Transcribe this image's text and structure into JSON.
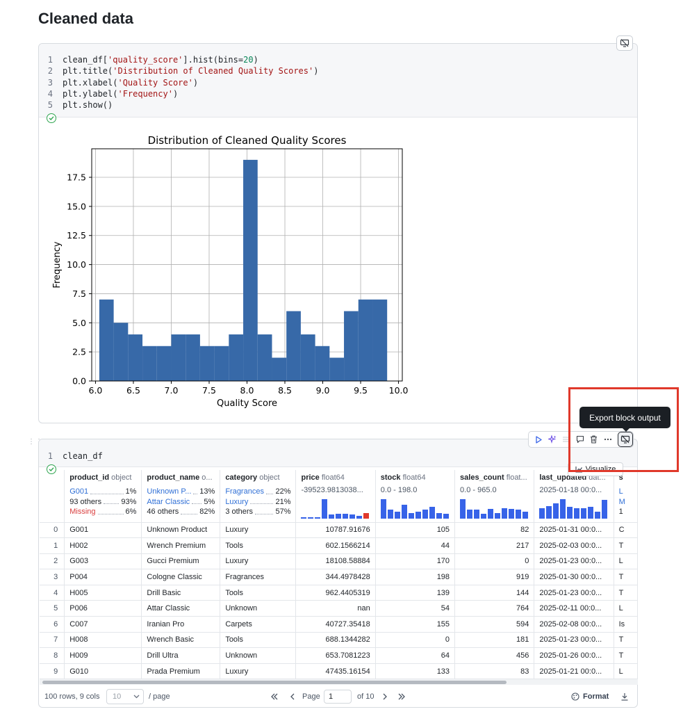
{
  "page": {
    "title": "Cleaned data"
  },
  "cell1": {
    "code_lines": [
      {
        "num": "1",
        "tokens": [
          {
            "t": "clean_df[",
            "c": "txt"
          },
          {
            "t": "'quality_score'",
            "c": "str"
          },
          {
            "t": "].hist(bins=",
            "c": "txt"
          },
          {
            "t": "20",
            "c": "num"
          },
          {
            "t": ")",
            "c": "txt"
          }
        ]
      },
      {
        "num": "2",
        "tokens": [
          {
            "t": "plt.title(",
            "c": "txt"
          },
          {
            "t": "'Distribution of Cleaned Quality Scores'",
            "c": "str"
          },
          {
            "t": ")",
            "c": "txt"
          }
        ]
      },
      {
        "num": "3",
        "tokens": [
          {
            "t": "plt.xlabel(",
            "c": "txt"
          },
          {
            "t": "'Quality Score'",
            "c": "str"
          },
          {
            "t": ")",
            "c": "txt"
          }
        ]
      },
      {
        "num": "4",
        "tokens": [
          {
            "t": "plt.ylabel(",
            "c": "txt"
          },
          {
            "t": "'Frequency'",
            "c": "str"
          },
          {
            "t": ")",
            "c": "txt"
          }
        ]
      },
      {
        "num": "5",
        "tokens": [
          {
            "t": "plt.show()",
            "c": "txt"
          }
        ]
      }
    ]
  },
  "chart_data": {
    "type": "bar",
    "title": "Distribution of Cleaned Quality Scores",
    "xlabel": "Quality Score",
    "ylabel": "Frequency",
    "bin_edges": [
      6.05,
      6.24,
      6.43,
      6.62,
      6.81,
      7.0,
      7.19,
      7.38,
      7.57,
      7.76,
      7.95,
      8.14,
      8.33,
      8.52,
      8.71,
      8.9,
      9.09,
      9.28,
      9.47,
      9.66,
      9.85
    ],
    "values": [
      7,
      5,
      4,
      3,
      3,
      4,
      4,
      3,
      3,
      4,
      19,
      4,
      2,
      6,
      4,
      3,
      2,
      6,
      7,
      7
    ],
    "xlim": [
      5.95,
      10.05
    ],
    "ylim": [
      0,
      19.95
    ],
    "xticks": [
      "6.0",
      "6.5",
      "7.0",
      "7.5",
      "8.0",
      "8.5",
      "9.0",
      "9.5",
      "10.0"
    ],
    "xtick_values": [
      6.0,
      6.5,
      7.0,
      7.5,
      8.0,
      8.5,
      9.0,
      9.5,
      10.0
    ],
    "yticks": [
      "0.0",
      "2.5",
      "5.0",
      "7.5",
      "10.0",
      "12.5",
      "15.0",
      "17.5"
    ],
    "ytick_values": [
      0,
      2.5,
      5,
      7.5,
      10,
      12.5,
      15,
      17.5
    ],
    "grid": true,
    "bar_color": "#3769a8"
  },
  "cell2": {
    "code_lines": [
      {
        "num": "1",
        "tokens": [
          {
            "t": "clean_df",
            "c": "txt"
          }
        ]
      }
    ],
    "tooltip": "Export block output",
    "visualize_label": "Visualize",
    "toolbar_icons": [
      "run-icon",
      "ai-sparkle-icon",
      "list-icon",
      "comment-icon",
      "trash-icon",
      "more-icon"
    ]
  },
  "table": {
    "columns": [
      {
        "name": "product_id",
        "type": "object",
        "kind": "cat",
        "stats": [
          {
            "label": "G001",
            "pct": "1%",
            "style": "blue"
          },
          {
            "label": "93 others",
            "pct": "93%",
            "style": ""
          },
          {
            "label": "Missing",
            "pct": "6%",
            "style": "red"
          }
        ]
      },
      {
        "name": "product_name",
        "type": "o...",
        "kind": "cat",
        "stats": [
          {
            "label": "Unknown P...",
            "pct": "13%",
            "style": "blue"
          },
          {
            "label": "Attar Classic",
            "pct": "5%",
            "style": "blue"
          },
          {
            "label": "46 others",
            "pct": "82%",
            "style": ""
          }
        ]
      },
      {
        "name": "category",
        "type": "object",
        "kind": "cat",
        "stats": [
          {
            "label": "Fragrances",
            "pct": "22%",
            "style": "blue"
          },
          {
            "label": "Luxury",
            "pct": "21%",
            "style": "blue"
          },
          {
            "label": "3 others",
            "pct": "57%",
            "style": ""
          }
        ]
      },
      {
        "name": "price",
        "type": "float64",
        "kind": "num",
        "range": "-39523.9813038...",
        "hist": [
          0.05,
          0.05,
          0.05,
          1.0,
          0.2,
          0.25,
          0.25,
          0.2,
          0.15,
          0.3
        ],
        "last_red": true
      },
      {
        "name": "stock",
        "type": "float64",
        "kind": "num",
        "range": "0.0 - 198.0",
        "hist": [
          1.0,
          0.45,
          0.35,
          0.7,
          0.3,
          0.35,
          0.45,
          0.6,
          0.3,
          0.25
        ],
        "last_red": false
      },
      {
        "name": "sales_count",
        "type": "float...",
        "kind": "num",
        "range": "0.0 - 965.0",
        "hist": [
          1.0,
          0.45,
          0.45,
          0.25,
          0.5,
          0.3,
          0.55,
          0.5,
          0.45,
          0.35
        ],
        "last_red": false
      },
      {
        "name": "last_updated",
        "type": "dat...",
        "kind": "num",
        "range": "2025-01-18 00:0...",
        "hist": [
          0.55,
          0.65,
          0.8,
          1.0,
          0.6,
          0.55,
          0.55,
          0.6,
          0.35,
          0.95
        ],
        "last_red": false
      },
      {
        "name": "s",
        "type": "",
        "kind": "cut",
        "stats_letters": [
          "L",
          "M",
          "1"
        ]
      }
    ],
    "rows": [
      {
        "idx": "0",
        "cells": [
          "G001",
          "Unknown Product",
          "Luxury",
          "10787.91676",
          "105",
          "82",
          "2025-01-31 00:0...",
          "C"
        ]
      },
      {
        "idx": "1",
        "cells": [
          "H002",
          "Wrench Premium",
          "Tools",
          "602.1566214",
          "44",
          "217",
          "2025-02-03 00:0...",
          "T"
        ]
      },
      {
        "idx": "2",
        "cells": [
          "G003",
          "Gucci Premium",
          "Luxury",
          "18108.58884",
          "170",
          "0",
          "2025-01-23 00:0...",
          "L"
        ]
      },
      {
        "idx": "3",
        "cells": [
          "P004",
          "Cologne Classic",
          "Fragrances",
          "344.4978428",
          "198",
          "919",
          "2025-01-30 00:0...",
          "T"
        ]
      },
      {
        "idx": "4",
        "cells": [
          "H005",
          "Drill Basic",
          "Tools",
          "962.4405319",
          "139",
          "144",
          "2025-01-23 00:0...",
          "T"
        ]
      },
      {
        "idx": "5",
        "cells": [
          "P006",
          "Attar Classic",
          "Unknown",
          "nan",
          "54",
          "764",
          "2025-02-11 00:0...",
          "L"
        ]
      },
      {
        "idx": "6",
        "cells": [
          "C007",
          "Iranian Pro",
          "Carpets",
          "40727.35418",
          "155",
          "594",
          "2025-02-08 00:0...",
          "Is"
        ]
      },
      {
        "idx": "7",
        "cells": [
          "H008",
          "Wrench Basic",
          "Tools",
          "688.1344282",
          "0",
          "181",
          "2025-01-23 00:0...",
          "T"
        ]
      },
      {
        "idx": "8",
        "cells": [
          "H009",
          "Drill Ultra",
          "Unknown",
          "653.7081223",
          "64",
          "456",
          "2025-01-26 00:0...",
          "T"
        ]
      },
      {
        "idx": "9",
        "cells": [
          "G010",
          "Prada Premium",
          "Luxury",
          "47435.16154",
          "133",
          "83",
          "2025-01-21 00:0...",
          "L"
        ]
      }
    ]
  },
  "footer": {
    "summary": "100 rows, 9 cols",
    "page_size": "10",
    "per_page": "/ page",
    "page_label": "Page",
    "page_value": "1",
    "of_label": "of 10",
    "format_label": "Format"
  },
  "colors": {
    "accent_blue": "#3763e8",
    "link_blue": "#2f6fd6",
    "missing_red": "#d93c3c",
    "highlight_red": "#e0392b",
    "ok_green": "#2da44e"
  }
}
